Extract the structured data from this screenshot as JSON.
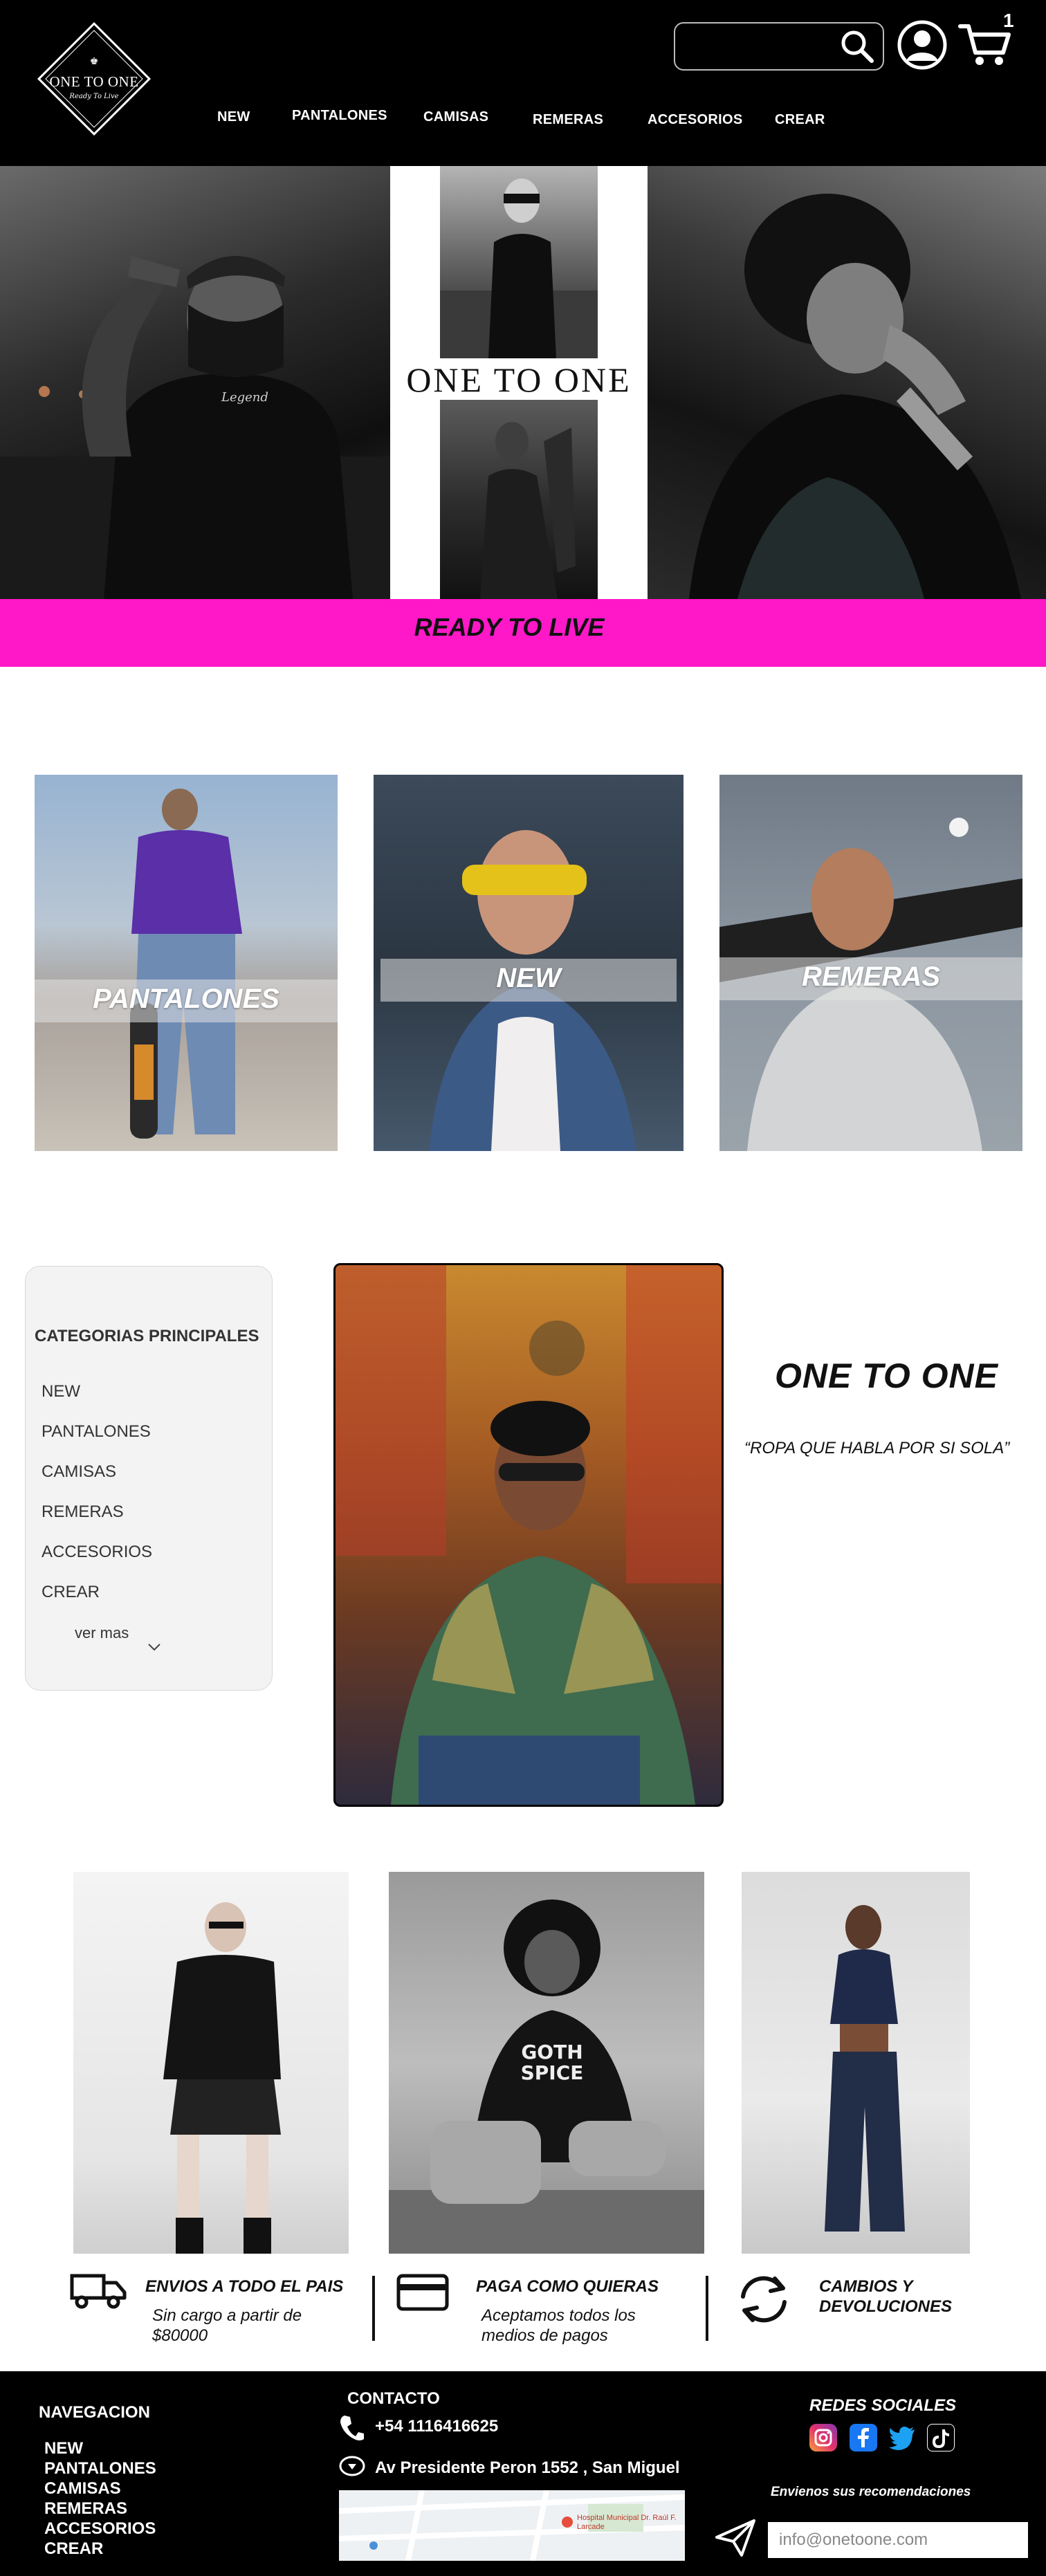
{
  "header": {
    "logo": {
      "name": "ONE TO ONE",
      "tagline": "Ready To Live"
    },
    "search": {
      "placeholder": ""
    },
    "cart_count": "1",
    "nav": [
      "NEW",
      "PANTALONES",
      "CAMISAS",
      "REMERAS",
      "ACCESORIOS",
      "CREAR"
    ]
  },
  "hero": {
    "brand": "ONE TO ONE",
    "banner": "READY TO LIVE"
  },
  "categories": [
    "PANTALONES",
    "NEW",
    "REMERAS"
  ],
  "sidebar": {
    "title": "CATEGORIAS PRINCIPALES",
    "items": [
      "NEW",
      "PANTALONES",
      "CAMISAS",
      "REMERAS",
      "ACCESORIOS",
      "CREAR"
    ],
    "more": "ver mas"
  },
  "feature": {
    "title": "ONE TO ONE",
    "quote": "“ROPA QUE HABLA POR SI SOLA”"
  },
  "benefits": [
    {
      "title": "ENVIOS A TODO EL PAIS",
      "desc_line1": "Sin cargo a partir de",
      "desc_line2": "$80000",
      "icon": "truck-icon"
    },
    {
      "title": "PAGA COMO QUIERAS",
      "desc_line1": "Aceptamos todos los",
      "desc_line2": "medios de pagos",
      "icon": "credit-card-icon"
    },
    {
      "title_line1": "CAMBIOS Y",
      "title_line2": "DEVOLUCIONES",
      "icon": "refresh-arrows-icon"
    }
  ],
  "footer": {
    "nav_title": "NAVEGACION",
    "nav": [
      "NEW",
      "PANTALONES",
      "CAMISAS",
      "REMERAS",
      "ACCESORIOS",
      "CREAR"
    ],
    "contact_title": "CONTACTO",
    "phone": "+54 1116416625",
    "address": "Av Presidente Peron 1552 , San Miguel",
    "social_title": "REDES SOCIALES",
    "social": [
      "instagram",
      "facebook",
      "twitter",
      "tiktok"
    ],
    "newsletter_label": "Envienos sus recomendaciones",
    "email_placeholder": "info@onetoone.com",
    "map_label": "Hospital Municipal Dr. Raúl F. Larcade"
  },
  "colors": {
    "accent": "#ff18c8",
    "header_bg": "#000000",
    "footer_bg": "#000000"
  }
}
